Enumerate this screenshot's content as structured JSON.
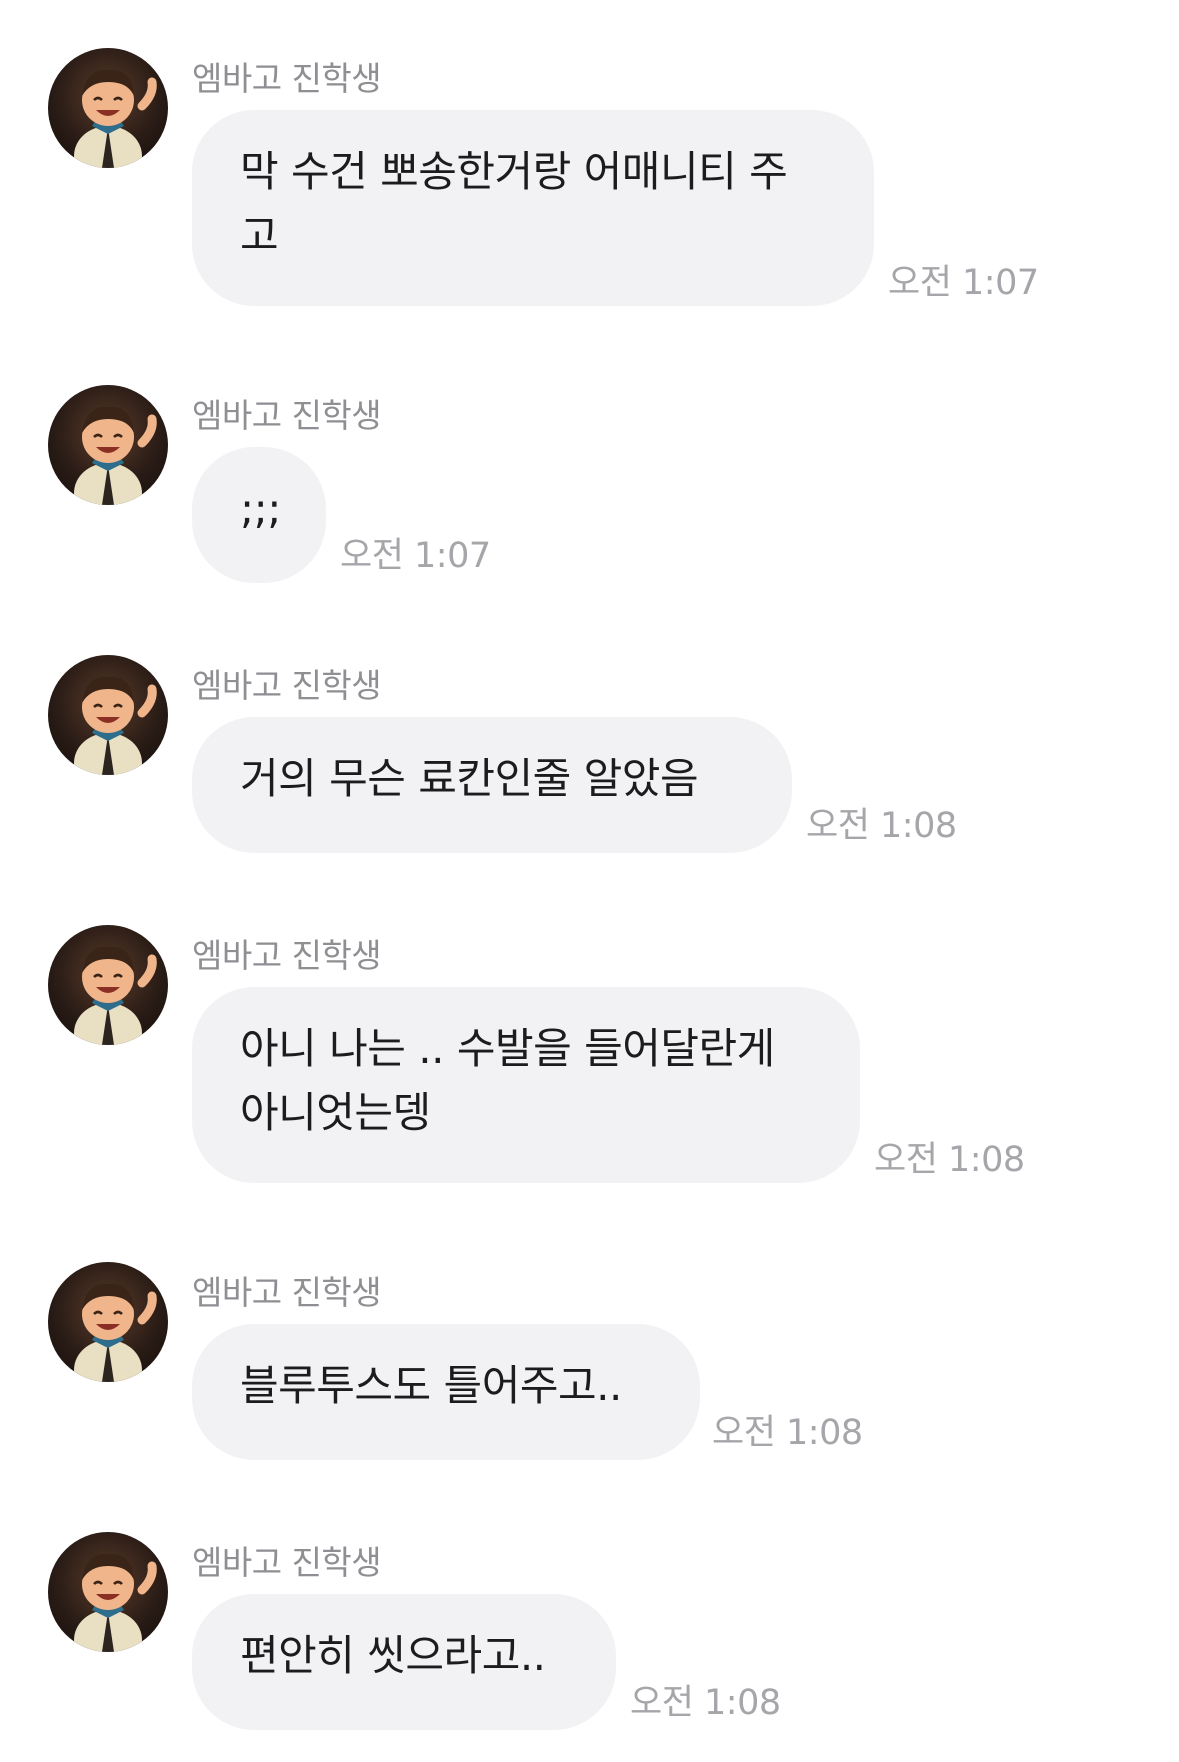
{
  "sender_name": "엠바고 진학생",
  "avatar_icon": "cartoon-character-avatar-icon",
  "messages": [
    {
      "lines": [
        "막 수건 뽀송한거랑 어매니티 주",
        "고"
      ],
      "time": "오전 1:07"
    },
    {
      "lines": [
        ";;;"
      ],
      "time": "오전 1:07"
    },
    {
      "lines": [
        "거의 무슨 료칸인줄 알았음"
      ],
      "time": "오전 1:08"
    },
    {
      "lines": [
        "아니 나는 .. 수발을 들어달란게",
        "아니엇는뎅"
      ],
      "time": "오전 1:08"
    },
    {
      "lines": [
        "블루투스도 틀어주고.."
      ],
      "time": "오전 1:08"
    },
    {
      "lines": [
        "편안히 씻으라고.."
      ],
      "time": "오전 1:08"
    }
  ]
}
